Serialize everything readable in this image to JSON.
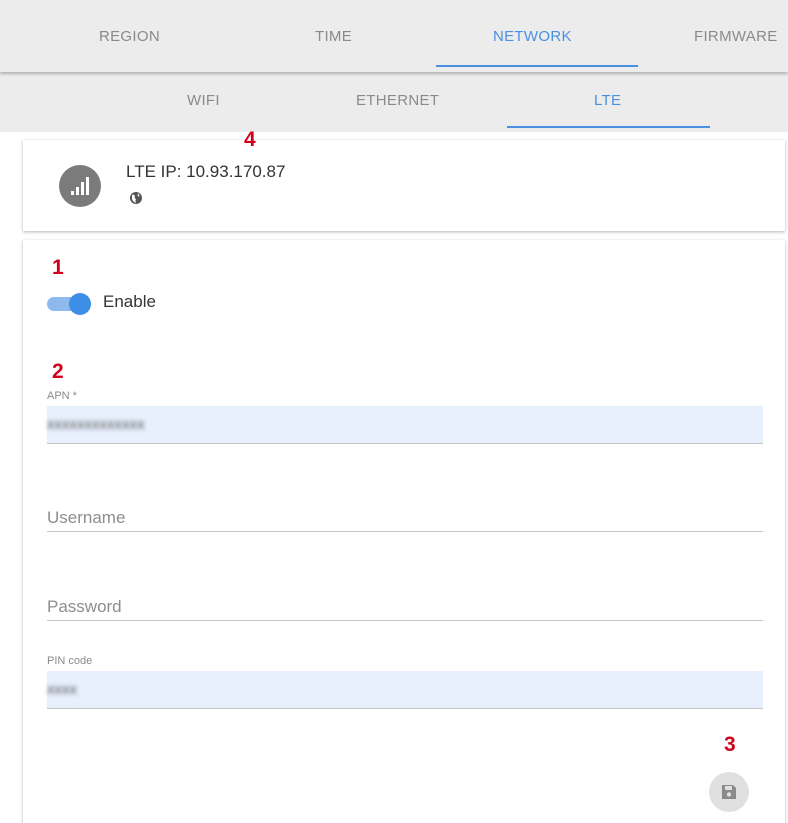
{
  "top_tabs": [
    {
      "label": "REGION"
    },
    {
      "label": "TIME"
    },
    {
      "label": "NETWORK"
    },
    {
      "label": "FIRMWARE"
    }
  ],
  "sub_tabs": [
    {
      "label": "WIFI"
    },
    {
      "label": "ETHERNET"
    },
    {
      "label": "LTE"
    }
  ],
  "active_top_tab": "NETWORK",
  "active_sub_tab": "LTE",
  "status": {
    "ip_text": "LTE IP: 10.93.170.87",
    "signal_icon": "signal-bars-icon",
    "globe_icon": "globe-icon"
  },
  "annotations": {
    "one": "1",
    "two": "2",
    "three": "3",
    "four": "4"
  },
  "form": {
    "enable_label": "Enable",
    "enabled": true,
    "apn_label": "APN *",
    "apn_value": "xxxxxxxxxxxxx",
    "username_placeholder": "Username",
    "password_placeholder": "Password",
    "pin_label": "PIN code",
    "pin_value": "xxxx",
    "save_icon": "floppy-disk-icon"
  },
  "colors": {
    "accent": "#4a90e2",
    "annotation": "#d0021b",
    "autofill_bg": "#e8f0fe",
    "toggle_on": "#3d8ee6"
  }
}
